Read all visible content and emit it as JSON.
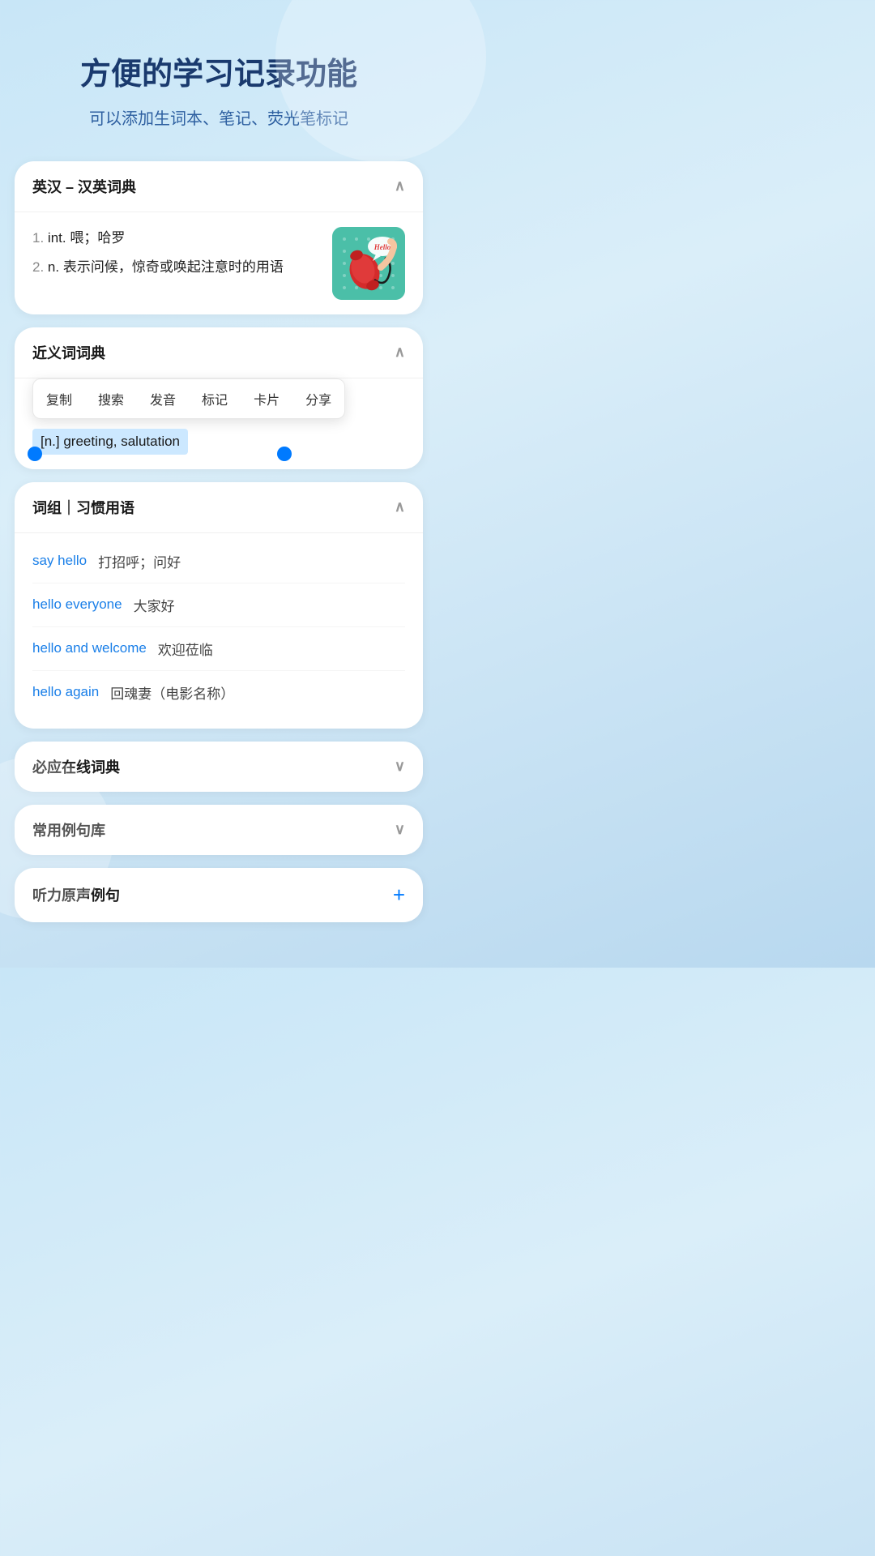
{
  "header": {
    "title": "方便的学习记录功能",
    "subtitle": "可以添加生词本、笔记、荧光笔标记"
  },
  "dictionary_section": {
    "label": "英汉 – 汉英词典",
    "chevron": "∧",
    "definitions": [
      {
        "index": "1.",
        "type": "int.",
        "text": "喂；哈罗"
      },
      {
        "index": "2.",
        "type": "n.",
        "text": "表示问候，惊奇或唤起注意时的用语"
      }
    ]
  },
  "synonym_section": {
    "label": "近义词词典",
    "chevron": "∧",
    "context_menu": [
      {
        "label": "复制"
      },
      {
        "label": "搜索"
      },
      {
        "label": "发音"
      },
      {
        "label": "标记"
      },
      {
        "label": "卡片"
      },
      {
        "label": "分享"
      }
    ],
    "highlighted_text": "[n.] greeting, salutation"
  },
  "phrases_section": {
    "label": "词组｜习惯用语",
    "chevron": "∧",
    "items": [
      {
        "en": "say hello",
        "zh": "打招呼；问好"
      },
      {
        "en": "hello everyone",
        "zh": "大家好"
      },
      {
        "en": "hello and welcome",
        "zh": "欢迎莅临"
      },
      {
        "en": "hello again",
        "zh": "回魂妻（电影名称）"
      }
    ]
  },
  "collapsed_sections": [
    {
      "label": "必应在线词典"
    },
    {
      "label": "常用例句库"
    }
  ],
  "audio_section": {
    "label": "听力原声例句",
    "add_icon": "+"
  }
}
